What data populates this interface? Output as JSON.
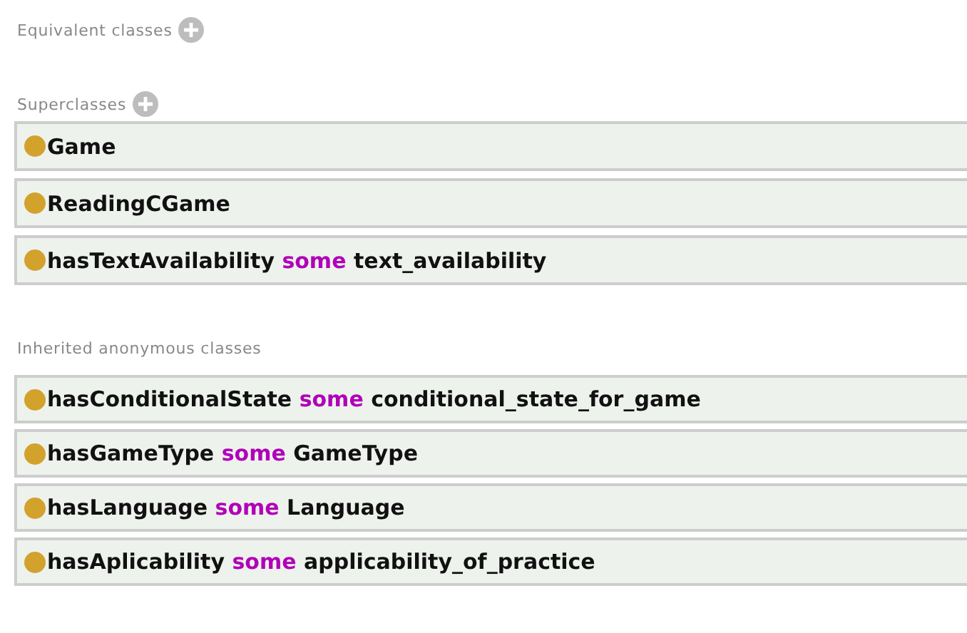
{
  "sections": [
    {
      "title": "Equivalent classes",
      "addable": true
    },
    {
      "title": "Superclasses",
      "addable": true,
      "rows": [
        {
          "kind": "class",
          "label": "Game"
        },
        {
          "kind": "class",
          "label": "ReadingCGame"
        },
        {
          "kind": "restriction",
          "property": "hasTextAvailability",
          "quantifier": "some",
          "filler": "text_availability"
        }
      ]
    },
    {
      "title": "Inherited anonymous classes",
      "addable": false,
      "rows": [
        {
          "kind": "restriction",
          "property": "hasConditionalState",
          "quantifier": "some",
          "filler": "conditional_state_for_game"
        },
        {
          "kind": "restriction",
          "property": "hasGameType",
          "quantifier": "some",
          "filler": "GameType"
        },
        {
          "kind": "restriction",
          "property": "hasLanguage",
          "quantifier": "some",
          "filler": "Language"
        },
        {
          "kind": "restriction",
          "property": "hasAplicability",
          "quantifier": "some",
          "filler": "applicability_of_practice"
        }
      ]
    }
  ]
}
